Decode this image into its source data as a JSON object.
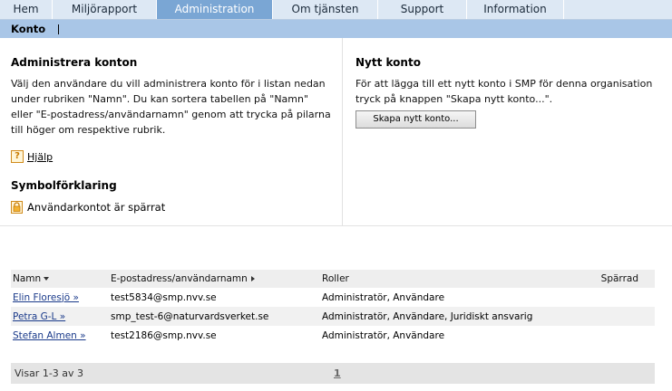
{
  "nav": {
    "tabs": [
      {
        "label": "Hem"
      },
      {
        "label": "Miljörapport"
      },
      {
        "label": "Administration"
      },
      {
        "label": "Om tjänsten"
      },
      {
        "label": "Support"
      },
      {
        "label": "Information"
      }
    ],
    "active_index": 2,
    "sub_label": "Konto"
  },
  "left": {
    "title": "Administrera konton",
    "text": "Välj den användare du vill administrera konto för i listan nedan under rubriken \"Namn\". Du kan sortera tabellen på \"Namn\" eller \"E-postadress/användarnamn\" genom att trycka på pilarna till höger om respektive rubrik.",
    "help_label": "Hjälp",
    "symbol_title": "Symbolförklaring",
    "lock_label": "Användarkontot är spärrat"
  },
  "right": {
    "title": "Nytt konto",
    "text": "För att lägga till ett nytt konto i SMP för denna organisation tryck på knappen \"Skapa nytt konto...\".",
    "button_label": "Skapa nytt konto..."
  },
  "table": {
    "headers": {
      "name": "Namn",
      "email": "E-postadress/användarnamn",
      "roles": "Roller",
      "locked": "Spärrad"
    },
    "rows": [
      {
        "name": "Elin Floresjö »",
        "email": "test5834@smp.nvv.se",
        "roles": "Administratör, Användare",
        "locked": ""
      },
      {
        "name": "Petra G-L »",
        "email": "smp_test-6@naturvardsverket.se",
        "roles": "Administratör, Användare, Juridiskt ansvarig",
        "locked": ""
      },
      {
        "name": "Stefan Almen »",
        "email": "test2186@smp.nvv.se",
        "roles": "Administratör, Användare",
        "locked": ""
      }
    ]
  },
  "footer": {
    "count_text": "Visar 1-3 av 3",
    "page": "1"
  },
  "colors": {
    "active_tab": "#7aa6d4",
    "subnav": "#a9c6e7",
    "tabbar": "#dde8f4",
    "link": "#1a3a8a"
  },
  "icons": {
    "help": "question-icon",
    "lock": "lock-icon",
    "sort_name": "sort-down-arrow-icon",
    "sort_email": "sort-right-arrow-icon"
  }
}
